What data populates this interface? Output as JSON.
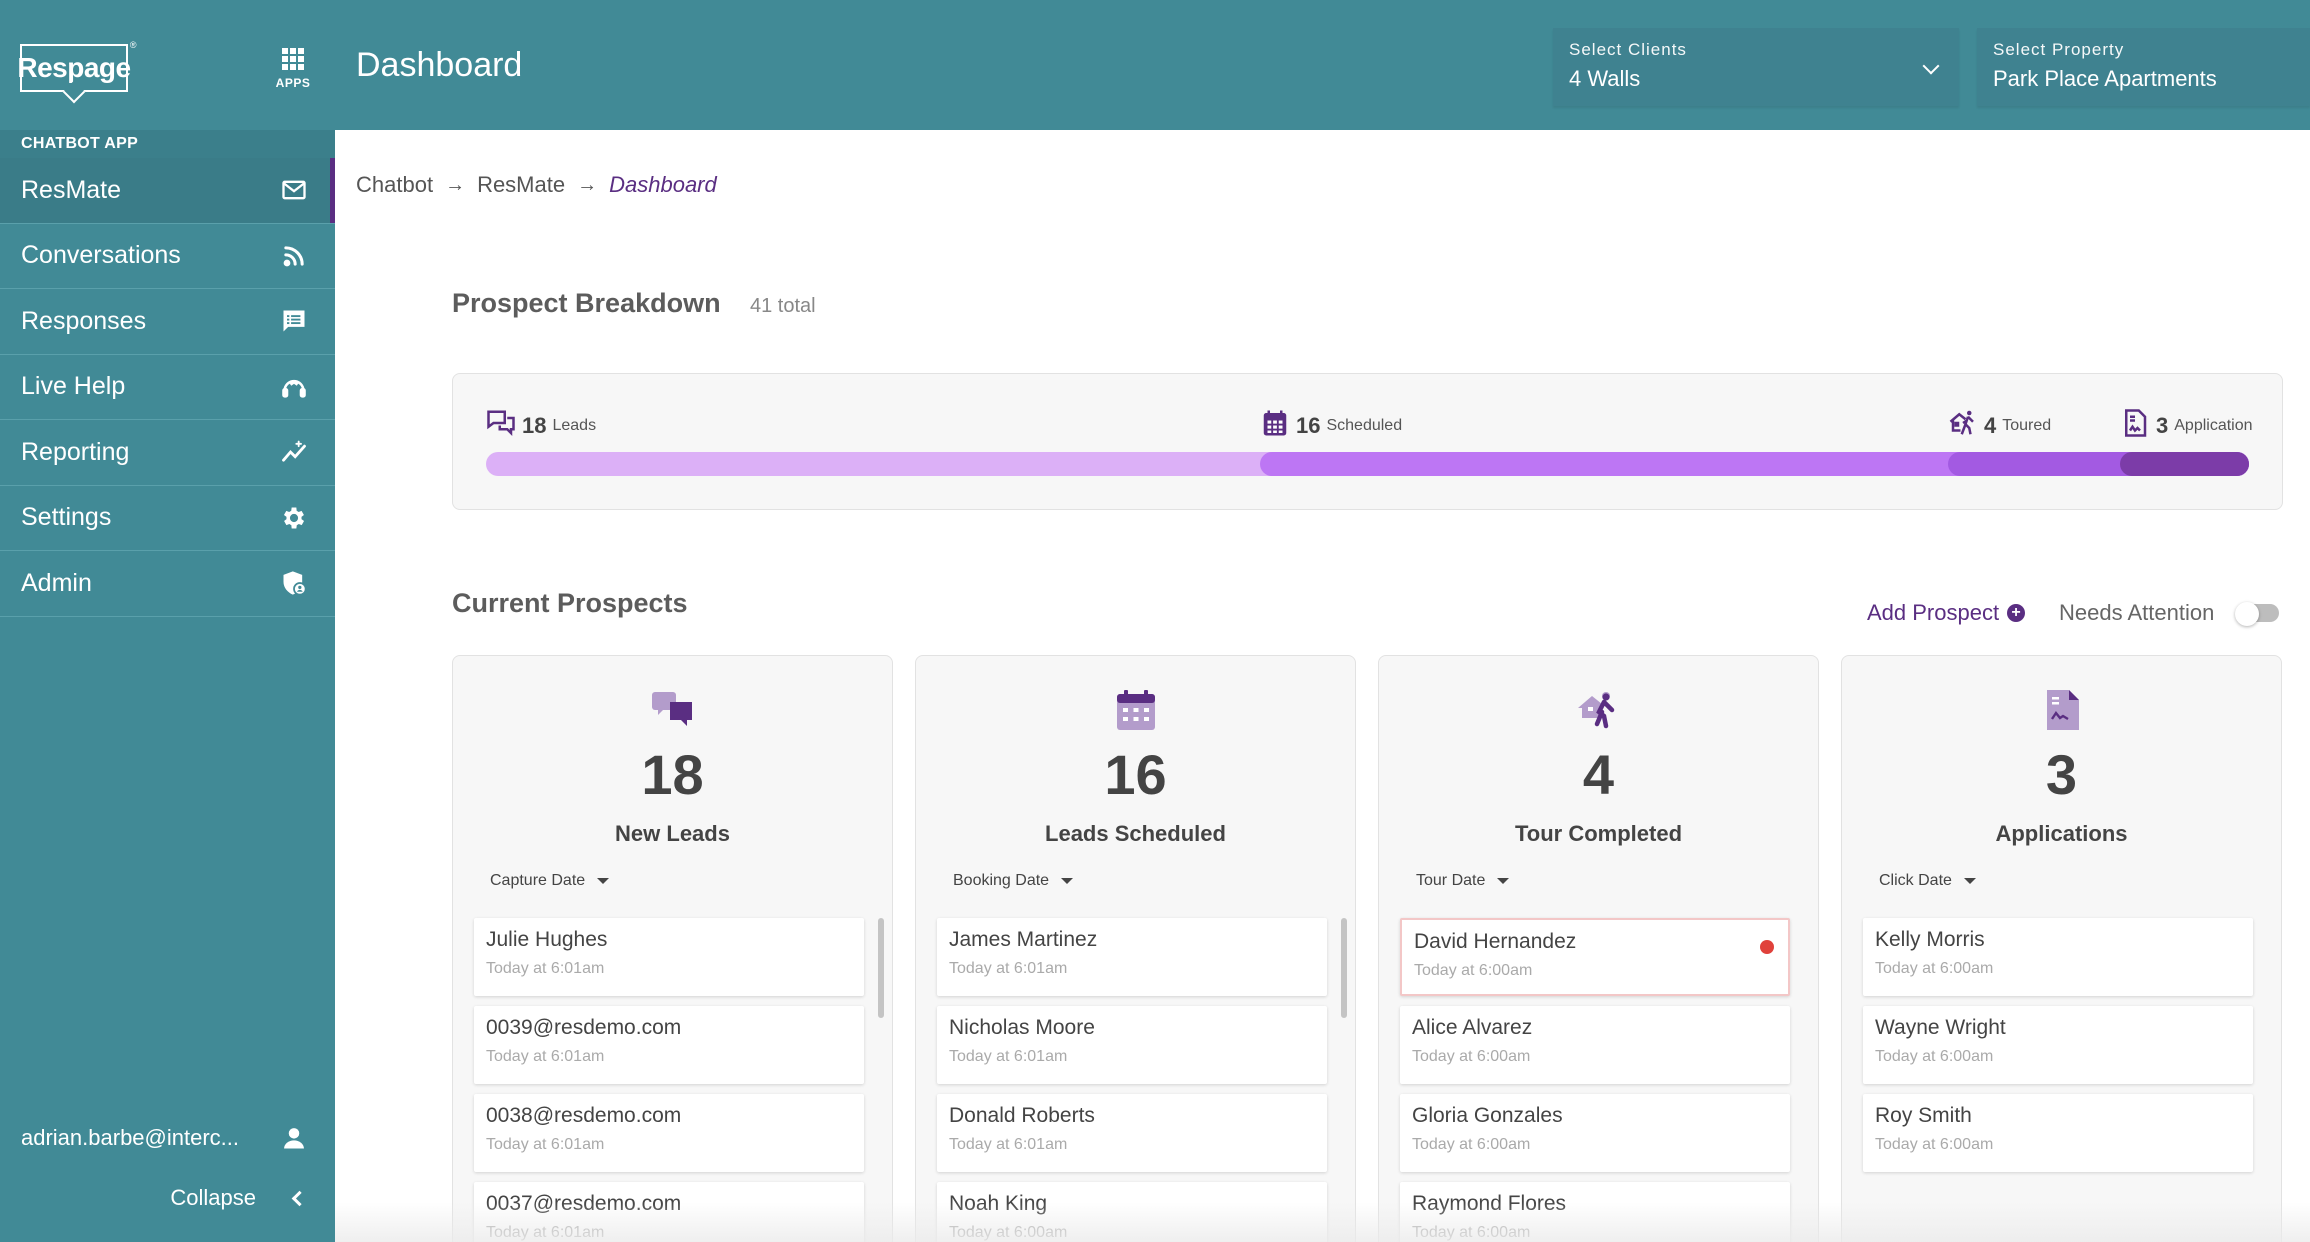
{
  "header": {
    "logo": "Respage",
    "logo_mark": "®",
    "apps_label": "APPS",
    "title": "Dashboard",
    "client_select": {
      "label": "Select Clients",
      "value": "4 Walls"
    },
    "property_select": {
      "label": "Select Property",
      "value": "Park Place Apartments"
    }
  },
  "sidebar": {
    "section": "CHATBOT APP",
    "items": [
      {
        "label": "ResMate",
        "icon": "envelope-icon",
        "active": true
      },
      {
        "label": "Conversations",
        "icon": "rss-icon"
      },
      {
        "label": "Responses",
        "icon": "message-list-icon"
      },
      {
        "label": "Live Help",
        "icon": "headset-icon"
      },
      {
        "label": "Reporting",
        "icon": "chart-sparkle-icon"
      },
      {
        "label": "Settings",
        "icon": "gear-icon"
      },
      {
        "label": "Admin",
        "icon": "shield-user-icon"
      }
    ],
    "user": "adrian.barbe@interc...",
    "collapse": "Collapse"
  },
  "breadcrumb": {
    "items": [
      "Chatbot",
      "ResMate"
    ],
    "current": "Dashboard",
    "separator": "→"
  },
  "prospect_breakdown": {
    "title": "Prospect Breakdown",
    "total": "41 total",
    "stages": [
      {
        "count": "18",
        "label": "Leads",
        "icon": "chat-bubbles-icon",
        "color": "#dcb0f7"
      },
      {
        "count": "16",
        "label": "Scheduled",
        "icon": "calendar-icon",
        "color": "#bd76f4"
      },
      {
        "count": "4",
        "label": "Toured",
        "icon": "house-walk-icon",
        "color": "#a35ae2"
      },
      {
        "count": "3",
        "label": "Application",
        "icon": "document-sign-icon",
        "color": "#7c3ca8"
      }
    ],
    "values": [
      18,
      16,
      4,
      3
    ]
  },
  "current_prospects": {
    "title": "Current Prospects",
    "add_prospect": "Add Prospect",
    "needs_attention": "Needs Attention",
    "needs_attention_on": false,
    "columns": [
      {
        "count": "18",
        "title": "New Leads",
        "sort": "Capture Date",
        "icon": "chat-bubbles-icon",
        "items": [
          {
            "name": "Julie Hughes",
            "time": "Today at 6:01am"
          },
          {
            "name": "0039@resdemo.com",
            "time": "Today at 6:01am"
          },
          {
            "name": "0038@resdemo.com",
            "time": "Today at 6:01am"
          },
          {
            "name": "0037@resdemo.com",
            "time": "Today at 6:01am"
          }
        ]
      },
      {
        "count": "16",
        "title": "Leads Scheduled",
        "sort": "Booking Date",
        "icon": "calendar-icon",
        "items": [
          {
            "name": "James Martinez",
            "time": "Today at 6:01am"
          },
          {
            "name": "Nicholas Moore",
            "time": "Today at 6:01am"
          },
          {
            "name": "Donald Roberts",
            "time": "Today at 6:01am"
          },
          {
            "name": "Noah King",
            "time": "Today at 6:00am"
          }
        ]
      },
      {
        "count": "4",
        "title": "Tour Completed",
        "sort": "Tour Date",
        "icon": "house-walk-icon",
        "items": [
          {
            "name": "David Hernandez",
            "time": "Today at 6:00am",
            "alert": true
          },
          {
            "name": "Alice Alvarez",
            "time": "Today at 6:00am"
          },
          {
            "name": "Gloria Gonzales",
            "time": "Today at 6:00am"
          },
          {
            "name": "Raymond Flores",
            "time": "Today at 6:00am"
          }
        ]
      },
      {
        "count": "3",
        "title": "Applications",
        "sort": "Click Date",
        "icon": "document-sign-icon",
        "items": [
          {
            "name": "Kelly Morris",
            "time": "Today at 6:00am"
          },
          {
            "name": "Wayne Wright",
            "time": "Today at 6:00am"
          },
          {
            "name": "Roy Smith",
            "time": "Today at 6:00am"
          }
        ]
      }
    ]
  },
  "colors": {
    "header": "#418a96",
    "accent": "#5a2e82",
    "alert": "#e0413b"
  }
}
